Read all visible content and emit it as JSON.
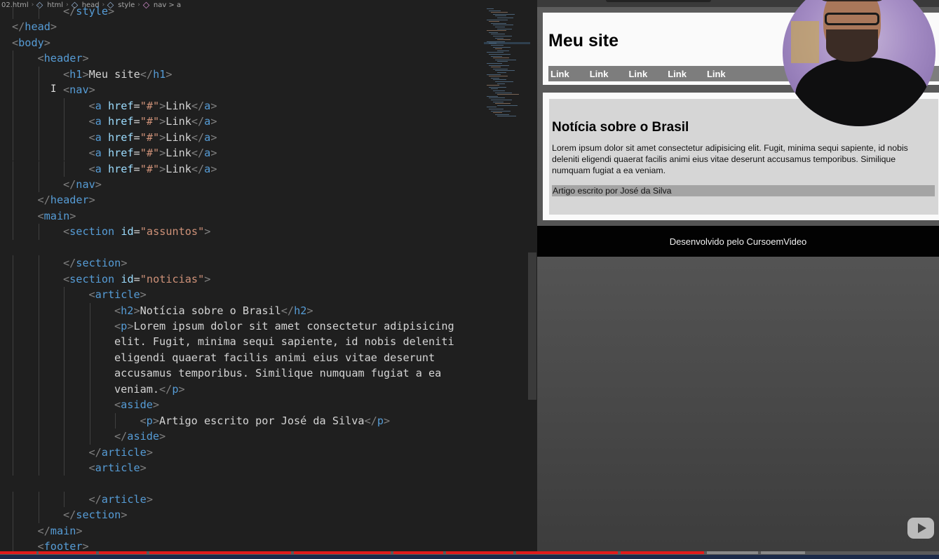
{
  "breadcrumb": [
    "02.html",
    "html",
    "head",
    "style",
    "nav > a"
  ],
  "code_lines": [
    {
      "indent": 3,
      "tokens": [
        [
          "br",
          "</"
        ],
        [
          "tag",
          "style"
        ],
        [
          "br",
          ">"
        ]
      ]
    },
    {
      "indent": 1,
      "tokens": [
        [
          "br",
          "</"
        ],
        [
          "tag",
          "head"
        ],
        [
          "br",
          ">"
        ]
      ]
    },
    {
      "indent": 1,
      "tokens": [
        [
          "br",
          "<"
        ],
        [
          "tag",
          "body"
        ],
        [
          "br",
          ">"
        ]
      ]
    },
    {
      "indent": 2,
      "tokens": [
        [
          "br",
          "<"
        ],
        [
          "tag",
          "header"
        ],
        [
          "br",
          ">"
        ]
      ]
    },
    {
      "indent": 3,
      "tokens": [
        [
          "br",
          "<"
        ],
        [
          "tag",
          "h1"
        ],
        [
          "br",
          ">"
        ],
        [
          "txt",
          "Meu site"
        ],
        [
          "br",
          "</"
        ],
        [
          "tag",
          "h1"
        ],
        [
          "br",
          ">"
        ]
      ]
    },
    {
      "indent": 3,
      "tokens": [
        [
          "br",
          "<"
        ],
        [
          "tag",
          "nav"
        ],
        [
          "br",
          ">"
        ]
      ]
    },
    {
      "indent": 4,
      "tokens": [
        [
          "br",
          "<"
        ],
        [
          "tag",
          "a"
        ],
        [
          "txt",
          " "
        ],
        [
          "attr",
          "href"
        ],
        [
          "txt",
          "="
        ],
        [
          "str",
          "\"#\""
        ],
        [
          "br",
          ">"
        ],
        [
          "txt",
          "Link"
        ],
        [
          "br",
          "</"
        ],
        [
          "tag",
          "a"
        ],
        [
          "br",
          ">"
        ]
      ]
    },
    {
      "indent": 4,
      "tokens": [
        [
          "br",
          "<"
        ],
        [
          "tag",
          "a"
        ],
        [
          "txt",
          " "
        ],
        [
          "attr",
          "href"
        ],
        [
          "txt",
          "="
        ],
        [
          "str",
          "\"#\""
        ],
        [
          "br",
          ">"
        ],
        [
          "txt",
          "Link"
        ],
        [
          "br",
          "</"
        ],
        [
          "tag",
          "a"
        ],
        [
          "br",
          ">"
        ]
      ]
    },
    {
      "indent": 4,
      "tokens": [
        [
          "br",
          "<"
        ],
        [
          "tag",
          "a"
        ],
        [
          "txt",
          " "
        ],
        [
          "attr",
          "href"
        ],
        [
          "txt",
          "="
        ],
        [
          "str",
          "\"#\""
        ],
        [
          "br",
          ">"
        ],
        [
          "txt",
          "Link"
        ],
        [
          "br",
          "</"
        ],
        [
          "tag",
          "a"
        ],
        [
          "br",
          ">"
        ]
      ]
    },
    {
      "indent": 4,
      "tokens": [
        [
          "br",
          "<"
        ],
        [
          "tag",
          "a"
        ],
        [
          "txt",
          " "
        ],
        [
          "attr",
          "href"
        ],
        [
          "txt",
          "="
        ],
        [
          "str",
          "\"#\""
        ],
        [
          "br",
          ">"
        ],
        [
          "txt",
          "Link"
        ],
        [
          "br",
          "</"
        ],
        [
          "tag",
          "a"
        ],
        [
          "br",
          ">"
        ]
      ]
    },
    {
      "indent": 4,
      "tokens": [
        [
          "br",
          "<"
        ],
        [
          "tag",
          "a"
        ],
        [
          "txt",
          " "
        ],
        [
          "attr",
          "href"
        ],
        [
          "txt",
          "="
        ],
        [
          "str",
          "\"#\""
        ],
        [
          "br",
          ">"
        ],
        [
          "txt",
          "Link"
        ],
        [
          "br",
          "</"
        ],
        [
          "tag",
          "a"
        ],
        [
          "br",
          ">"
        ]
      ]
    },
    {
      "indent": 3,
      "tokens": [
        [
          "br",
          "</"
        ],
        [
          "tag",
          "nav"
        ],
        [
          "br",
          ">"
        ]
      ]
    },
    {
      "indent": 2,
      "tokens": [
        [
          "br",
          "</"
        ],
        [
          "tag",
          "header"
        ],
        [
          "br",
          ">"
        ]
      ]
    },
    {
      "indent": 2,
      "tokens": [
        [
          "br",
          "<"
        ],
        [
          "tag",
          "main"
        ],
        [
          "br",
          ">"
        ]
      ]
    },
    {
      "indent": 3,
      "tokens": [
        [
          "br",
          "<"
        ],
        [
          "tag",
          "section"
        ],
        [
          "txt",
          " "
        ],
        [
          "attr",
          "id"
        ],
        [
          "txt",
          "="
        ],
        [
          "str",
          "\"assuntos\""
        ],
        [
          "br",
          ">"
        ]
      ]
    },
    {
      "indent": 0,
      "tokens": []
    },
    {
      "indent": 3,
      "tokens": [
        [
          "br",
          "</"
        ],
        [
          "tag",
          "section"
        ],
        [
          "br",
          ">"
        ]
      ]
    },
    {
      "indent": 3,
      "tokens": [
        [
          "br",
          "<"
        ],
        [
          "tag",
          "section"
        ],
        [
          "txt",
          " "
        ],
        [
          "attr",
          "id"
        ],
        [
          "txt",
          "="
        ],
        [
          "str",
          "\"noticias\""
        ],
        [
          "br",
          ">"
        ]
      ]
    },
    {
      "indent": 4,
      "tokens": [
        [
          "br",
          "<"
        ],
        [
          "tag",
          "article"
        ],
        [
          "br",
          ">"
        ]
      ]
    },
    {
      "indent": 5,
      "tokens": [
        [
          "br",
          "<"
        ],
        [
          "tag",
          "h2"
        ],
        [
          "br",
          ">"
        ],
        [
          "txt",
          "Notícia sobre o Brasil"
        ],
        [
          "br",
          "</"
        ],
        [
          "tag",
          "h2"
        ],
        [
          "br",
          ">"
        ]
      ]
    },
    {
      "indent": 5,
      "tokens": [
        [
          "br",
          "<"
        ],
        [
          "tag",
          "p"
        ],
        [
          "br",
          ">"
        ],
        [
          "txt",
          "Lorem ipsum dolor sit amet consectetur adipisicing"
        ]
      ]
    },
    {
      "indent": 5,
      "tokens": [
        [
          "txt",
          "elit. Fugit, minima sequi sapiente, id nobis deleniti"
        ]
      ]
    },
    {
      "indent": 5,
      "tokens": [
        [
          "txt",
          "eligendi quaerat facilis animi eius vitae deserunt"
        ]
      ]
    },
    {
      "indent": 5,
      "tokens": [
        [
          "txt",
          "accusamus temporibus. Similique numquam fugiat a ea"
        ]
      ]
    },
    {
      "indent": 5,
      "tokens": [
        [
          "txt",
          "veniam."
        ],
        [
          "br",
          "</"
        ],
        [
          "tag",
          "p"
        ],
        [
          "br",
          ">"
        ]
      ]
    },
    {
      "indent": 5,
      "tokens": [
        [
          "br",
          "<"
        ],
        [
          "tag",
          "aside"
        ],
        [
          "br",
          ">"
        ]
      ]
    },
    {
      "indent": 6,
      "tokens": [
        [
          "br",
          "<"
        ],
        [
          "tag",
          "p"
        ],
        [
          "br",
          ">"
        ],
        [
          "txt",
          "Artigo escrito por José da Silva"
        ],
        [
          "br",
          "</"
        ],
        [
          "tag",
          "p"
        ],
        [
          "br",
          ">"
        ]
      ]
    },
    {
      "indent": 5,
      "tokens": [
        [
          "br",
          "</"
        ],
        [
          "tag",
          "aside"
        ],
        [
          "br",
          ">"
        ]
      ]
    },
    {
      "indent": 4,
      "tokens": [
        [
          "br",
          "</"
        ],
        [
          "tag",
          "article"
        ],
        [
          "br",
          ">"
        ]
      ]
    },
    {
      "indent": 4,
      "tokens": [
        [
          "br",
          "<"
        ],
        [
          "tag",
          "article"
        ],
        [
          "br",
          ">"
        ]
      ]
    },
    {
      "indent": 0,
      "tokens": []
    },
    {
      "indent": 4,
      "tokens": [
        [
          "br",
          "</"
        ],
        [
          "tag",
          "article"
        ],
        [
          "br",
          ">"
        ]
      ]
    },
    {
      "indent": 3,
      "tokens": [
        [
          "br",
          "</"
        ],
        [
          "tag",
          "section"
        ],
        [
          "br",
          ">"
        ]
      ]
    },
    {
      "indent": 2,
      "tokens": [
        [
          "br",
          "</"
        ],
        [
          "tag",
          "main"
        ],
        [
          "br",
          ">"
        ]
      ]
    },
    {
      "indent": 2,
      "tokens": [
        [
          "br",
          "<"
        ],
        [
          "tag",
          "footer"
        ],
        [
          "br",
          ">"
        ]
      ]
    }
  ],
  "preview": {
    "site_title": "Meu site",
    "nav_links": [
      "Link",
      "Link",
      "Link",
      "Link",
      "Link"
    ],
    "article_title": "Notícia sobre o Brasil",
    "article_body": "Lorem ipsum dolor sit amet consectetur adipisicing elit. Fugit, minima sequi sapiente, id nobis deleniti eligendi quaerat facilis animi eius vitae deserunt accusamus temporibus. Similique numquam fugiat a ea veniam.",
    "article_aside": "Artigo escrito por José da Silva",
    "footer_text": "Desenvolvido pelo CursoemVideo"
  },
  "colors": {
    "tag": "#569cd6",
    "attr": "#9cdcfe",
    "string": "#ce9178",
    "bracket": "#808080",
    "text": "#d4d4d4",
    "progress_played": "#e01b1b"
  }
}
